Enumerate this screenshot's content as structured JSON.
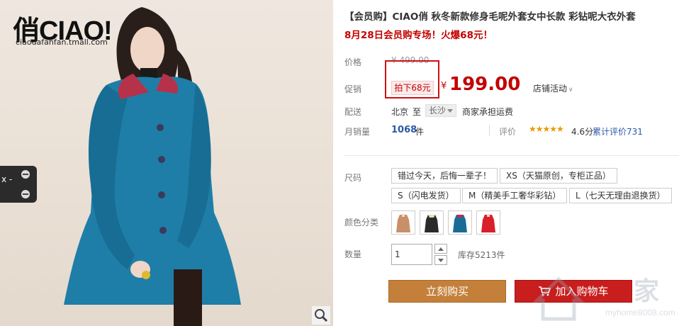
{
  "image_panel": {
    "brand_logo": "俏CIAO!",
    "brand_url": "ciaodafanfan.tmall.com",
    "side_tab_label": "x -"
  },
  "product": {
    "title": "【会员购】CIAO俏 秋冬新款修身毛呢外套女中长款 彩钻呢大衣外套",
    "subtitle": "8月28日会员购专场！火爆68元！"
  },
  "price_section": {
    "price_label": "价格",
    "original_price": "¥ 499.00",
    "promo_label": "促销",
    "promo_tag": "拍下68元",
    "currency": "¥",
    "price": "199.00",
    "store_activity": "店铺活动"
  },
  "shipping": {
    "label": "配送",
    "from": "北京",
    "to_word": "至",
    "city": "长沙",
    "note": "商家承担运费"
  },
  "sales": {
    "label": "月销量",
    "count": "1068",
    "unit": "件",
    "rating_label": "评价",
    "stars": "★★★★★",
    "score": "4.6分",
    "reviews": "累计评价731"
  },
  "size": {
    "label": "尺码",
    "options": [
      "错过今天，后悔一辈子！",
      "XS（天猫原创，专柜正品）",
      "S（闪电发货）",
      "M（精美手工奢华彩钻）",
      "L（七天无理由退换货）"
    ]
  },
  "color": {
    "label": "颜色分类",
    "swatches": [
      {
        "name": "camel",
        "hex": "#c8906a"
      },
      {
        "name": "black",
        "hex": "#2a2a2a"
      },
      {
        "name": "teal-blue",
        "hex": "#1a6c95"
      },
      {
        "name": "red",
        "hex": "#d8202a"
      }
    ]
  },
  "quantity": {
    "label": "数量",
    "value": "1",
    "stock": "库存5213件"
  },
  "actions": {
    "buy_now": "立刻购买",
    "add_to_cart": "加入购物车"
  },
  "watermark": {
    "brand": "家",
    "url": "myhome8008.com"
  },
  "colors": {
    "accent_red": "#c40000",
    "buy_button": "#c4803a",
    "cart_button": "#c81e1e",
    "link_blue": "#2b5aa6"
  }
}
